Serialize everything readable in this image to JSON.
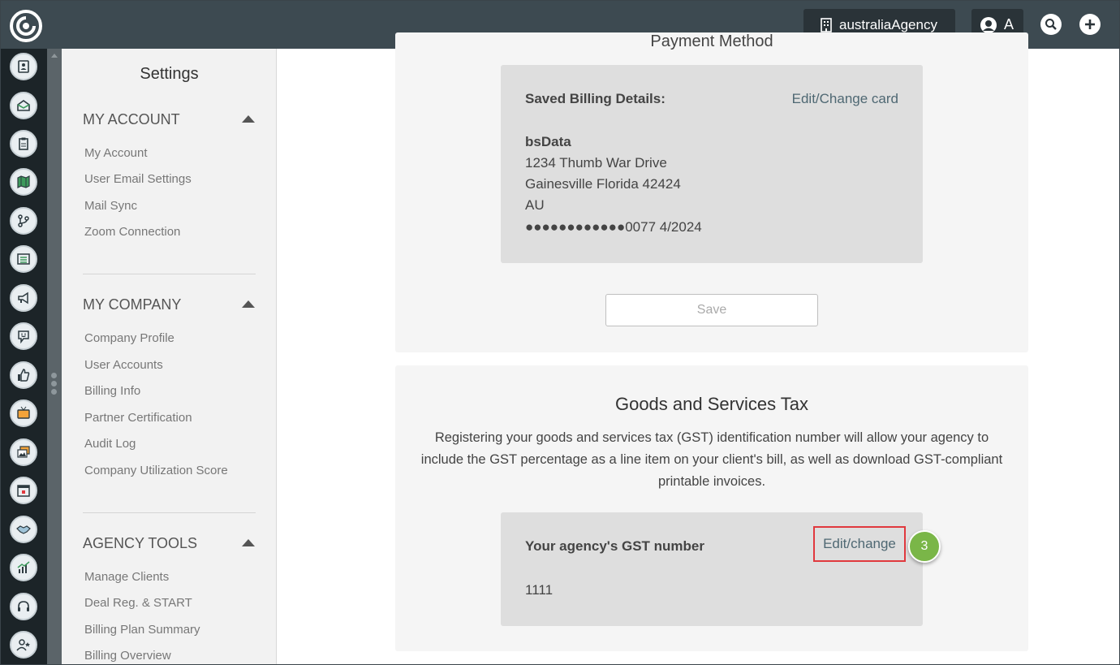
{
  "topbar": {
    "agency_name": "australiaAgency",
    "user_initial": "A"
  },
  "sidebar": {
    "title": "Settings",
    "sections": [
      {
        "heading": "MY ACCOUNT",
        "items": [
          "My Account",
          "User Email Settings",
          "Mail Sync",
          "Zoom Connection"
        ]
      },
      {
        "heading": "MY COMPANY",
        "items": [
          "Company Profile",
          "User Accounts",
          "Billing Info",
          "Partner Certification",
          "Audit Log",
          "Company Utilization Score"
        ]
      },
      {
        "heading": "AGENCY TOOLS",
        "items": [
          "Manage Clients",
          "Deal Reg. & START",
          "Billing Plan Summary",
          "Billing Overview"
        ]
      }
    ]
  },
  "rail": {
    "icons": [
      "contacts-icon",
      "inbox-icon",
      "clipboard-icon",
      "map-icon",
      "branch-icon",
      "list-icon",
      "megaphone-icon",
      "chat-smile-icon",
      "thumbs-up-icon",
      "tv-icon",
      "image-gallery-icon",
      "calendar-icon",
      "handshake-icon",
      "chart-growth-icon",
      "headset-icon",
      "user-star-icon"
    ]
  },
  "payment": {
    "title": "Payment Method",
    "saved_label": "Saved Billing Details:",
    "edit_link": "Edit/Change card",
    "name": "bsData",
    "address1": "1234 Thumb War Drive",
    "address2": "Gainesville Florida 42424",
    "country": "AU",
    "card": "●●●●●●●●●●●●0077 4/2024",
    "save_button": "Save"
  },
  "gst": {
    "title": "Goods and Services Tax",
    "description": "Registering your goods and services tax (GST) identification number will allow your agency to include the GST percentage as a line item on your client's bill, as well as download GST-compliant printable invoices.",
    "label": "Your agency's GST number",
    "edit_link": "Edit/change",
    "value": "1111"
  },
  "annotation": {
    "step": "3",
    "color": "#7ab648",
    "highlight_color": "#e0393e"
  }
}
